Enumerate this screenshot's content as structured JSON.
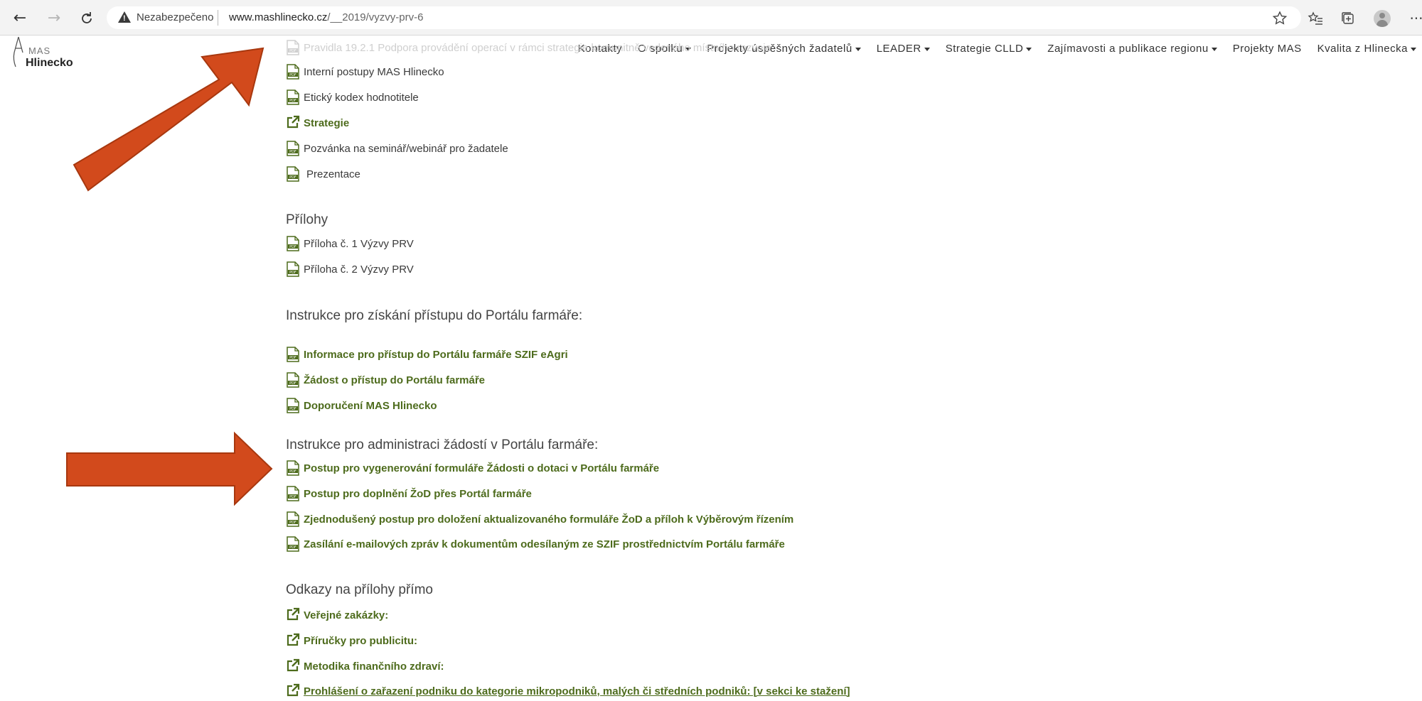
{
  "browser": {
    "back": "←",
    "forward": "→",
    "reload": "C",
    "security_label": "Nezabezpečeno",
    "url_host": "www.mashlinecko.cz",
    "url_path": "/__2019/vyzvy-prv-6",
    "more": "···"
  },
  "logo": {
    "mas": "MAS",
    "name": "Hlinecko"
  },
  "nav": {
    "items": [
      {
        "label": "Kontakty",
        "dropdown": false
      },
      {
        "label": "O spolku",
        "dropdown": true
      },
      {
        "label": "Projekty úspěšných žadatelů",
        "dropdown": true
      },
      {
        "label": "LEADER",
        "dropdown": true
      },
      {
        "label": "Strategie CLLD",
        "dropdown": true
      },
      {
        "label": "Zajímavosti a publikace regionu",
        "dropdown": true
      },
      {
        "label": "Projekty MAS",
        "dropdown": false
      },
      {
        "label": "Kvalita z Hlinecka",
        "dropdown": true
      }
    ]
  },
  "content": {
    "top_docs": [
      "Pravidla 19.2.1 Podpora provádění operací v rámci strategie komunitně vedeného místního rozvoje",
      "Interní postupy MAS Hlinecko",
      "Etický kodex hodnotitele",
      "Strategie",
      "Pozvánka na seminář/webinář pro žadatele",
      "Prezentace"
    ],
    "attachments_heading": "Přílohy",
    "attachments": [
      "Příloha č. 1 Výzvy PRV",
      "Příloha č. 2 Výzvy PRV"
    ],
    "access_heading": "Instrukce pro získání přístupu do Portálu farmáře:",
    "access_docs": [
      "Informace pro přístup do Portálu farmáře SZIF eAgri",
      "Žádost o přístup do Portálu farmáře",
      "Doporučení MAS Hlinecko"
    ],
    "admin_heading": "Instrukce pro administraci žádostí v Portálu farmáře:",
    "admin_docs": [
      "Postup pro vygenerování formuláře Žádosti o dotaci v Portálu farmáře",
      "Postup pro doplnění ŽoD přes Portál farmáře",
      "Zjednodušený postup pro doložení aktualizovaného formuláře ŽoD a příloh k Výběrovým řízením",
      "Zasílání e-mailových zpráv k dokumentům odesílaným ze SZIF prostřednictvím Portálu farmáře"
    ],
    "links_heading": "Odkazy na přílohy přímo",
    "links": [
      "Veřejné zakázky:",
      "Příručky pro publicitu:",
      "Metodika finančního zdraví:",
      "Prohlášení o zařazení podniku do kategorie mikropodniků, malých či středních podniků: [v sekci ke stažení]"
    ]
  },
  "colors": {
    "link": "#4d6b1c",
    "arrow": "#d24a1c",
    "icon": "#4d6b1c"
  }
}
